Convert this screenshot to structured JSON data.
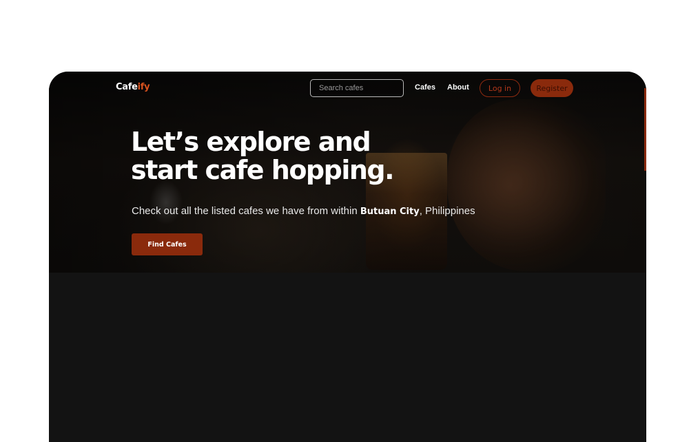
{
  "nav": {
    "logo_part1": "Cafe",
    "logo_part2": "ify",
    "search_placeholder": "Search cafes",
    "links": [
      "Cafes",
      "About"
    ],
    "login_label": "Log in",
    "register_label": "Register"
  },
  "hero": {
    "headline_line1": "Let’s explore and",
    "headline_line2": "start cafe hopping.",
    "sub_prefix": "Check out all the listed cafes we have from within ",
    "sub_city": "Butuan City",
    "sub_suffix": ", Philippines",
    "cta_label": "Find Cafes"
  },
  "colors": {
    "accent": "#8a2a0c",
    "accent_text": "#d8521e",
    "page_background": "#131313"
  }
}
